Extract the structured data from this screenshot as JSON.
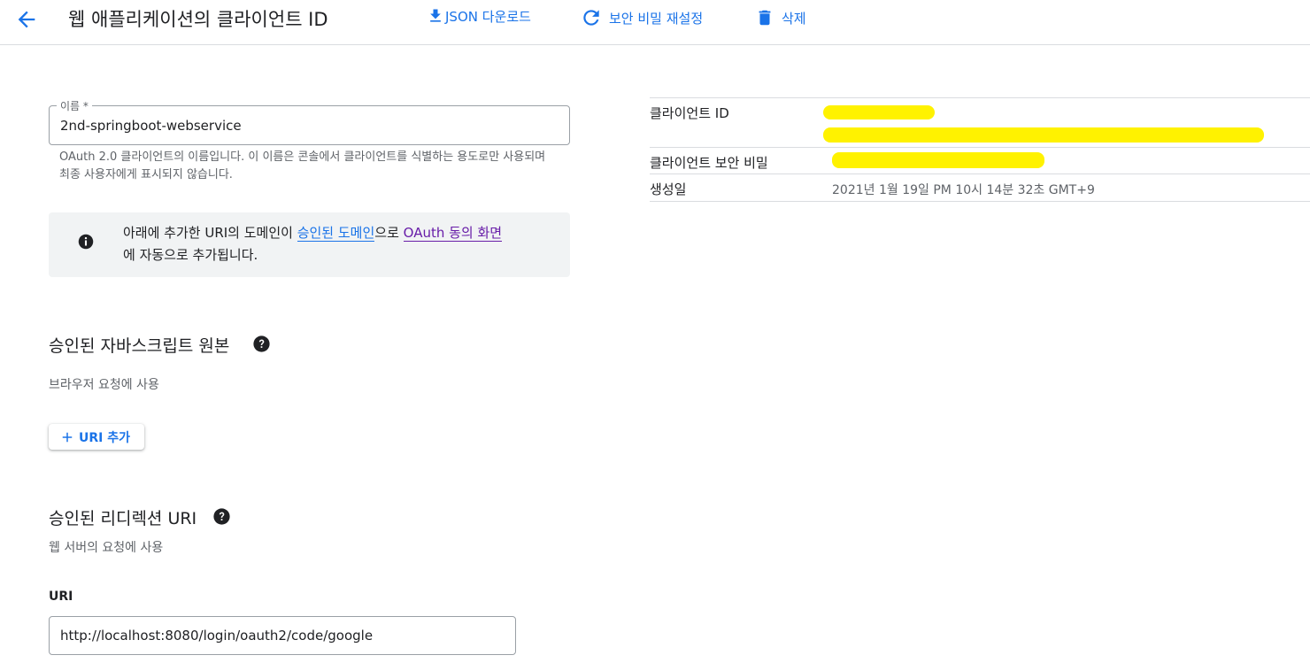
{
  "header": {
    "title": "웹 애플리케이션의 클라이언트 ID",
    "actions": {
      "download_json": "JSON 다운로드",
      "reset_secret": "보안 비밀 재설정",
      "delete": "삭제"
    }
  },
  "form": {
    "name_label": "이름 *",
    "name_value": "2nd-springboot-webservice",
    "name_hint": "OAuth 2.0 클라이언트의 이름입니다. 이 이름은 콘솔에서 클라이언트를 식별하는 용도로만 사용되며 최종 사용자에게 표시되지 않습니다."
  },
  "info_box": {
    "text_1": "아래에 추가한 URI의 도메인이 ",
    "link_1": "승인된 도메인",
    "text_2": "으로 ",
    "link_2": "OAuth 동의 화면",
    "text_3": "에 자동으로 추가됩니다."
  },
  "js_origins": {
    "title": "승인된 자바스크립트 원본",
    "subtitle": "브라우저 요청에 사용",
    "add_button": "URI 추가"
  },
  "redirect_uris": {
    "title": "승인된 리디렉션 URI",
    "subtitle": "웹 서버의 요청에 사용",
    "uri_label": "URI",
    "uri_value": "http://localhost:8080/login/oauth2/code/google"
  },
  "client_info": {
    "client_id_label": "클라이언트 ID",
    "client_secret_label": "클라이언트 보안 비밀",
    "created_label": "생성일",
    "created_value": "2021년 1월 19일 PM 10시 14분 32초 GMT+9"
  },
  "colors": {
    "accent": "#1a73e8",
    "visited_link": "#681da8",
    "redaction": "#fff200"
  },
  "icons": {
    "back": "arrow-back-icon",
    "download": "download-icon",
    "refresh": "refresh-icon",
    "delete": "trash-icon",
    "info": "info-icon",
    "help": "help-icon",
    "add": "plus-icon"
  }
}
